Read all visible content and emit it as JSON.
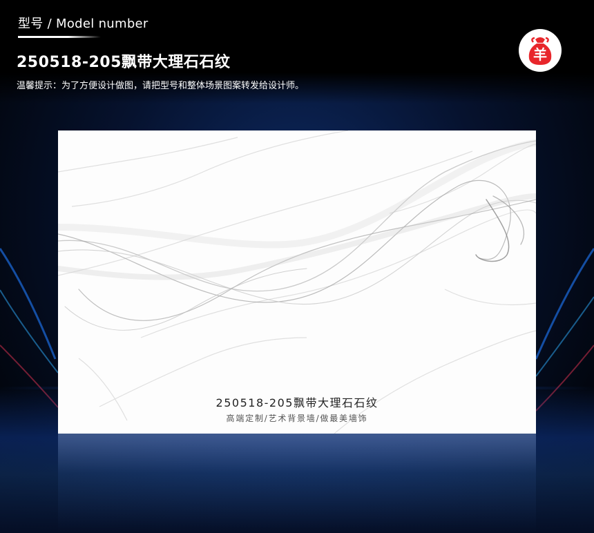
{
  "header": {
    "model_label": "型号 / Model number",
    "product_title": "250518-205飘带大理石石纹",
    "tip": "温馨提示：为了方便设计做图，请把型号和整体场景图案转发给设计师。"
  },
  "logo": {
    "icon": "money-bag-sheep-icon",
    "glyph": "羊",
    "color": "#e8262b"
  },
  "panel": {
    "title": "250518-205飘带大理石石纹",
    "subtitle": "高端定制/艺术背景墙/做最美墙饰"
  },
  "colors": {
    "background": "#06122e",
    "panel": "#fdfdfd",
    "accent": "#e8262b"
  }
}
